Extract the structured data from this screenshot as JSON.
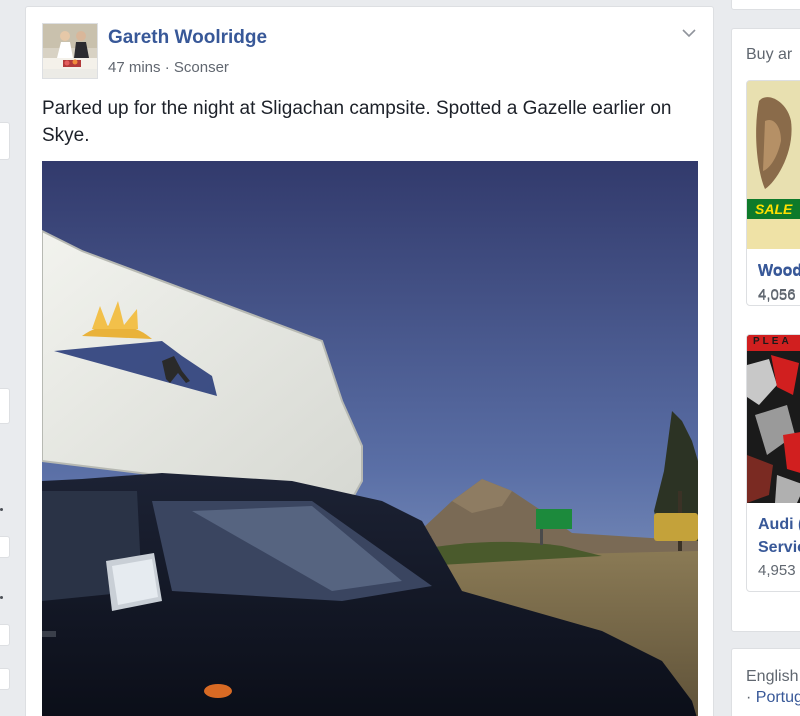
{
  "post": {
    "author": "Gareth Woolridge",
    "time": "47 mins",
    "separator": "·",
    "location": "Sconser",
    "text": "Parked up for the night at Sligachan campsite. Spotted a Gazelle earlier on Skye.",
    "menu_icon": "chevron-down-icon"
  },
  "sidebar": {
    "title": "Buy ar",
    "ads": [
      {
        "badge": "SALE",
        "name": "Wood",
        "count": "4,056"
      },
      {
        "badge_top": "PLEA",
        "name_line1": "Audi (",
        "name_line2": "Servic",
        "count": "4,953"
      }
    ]
  },
  "footer": {
    "language_1": "English",
    "separator": "·",
    "language_2": "Portug"
  },
  "colors": {
    "link": "#385898",
    "meta": "#616770",
    "background": "#e9ebee"
  }
}
